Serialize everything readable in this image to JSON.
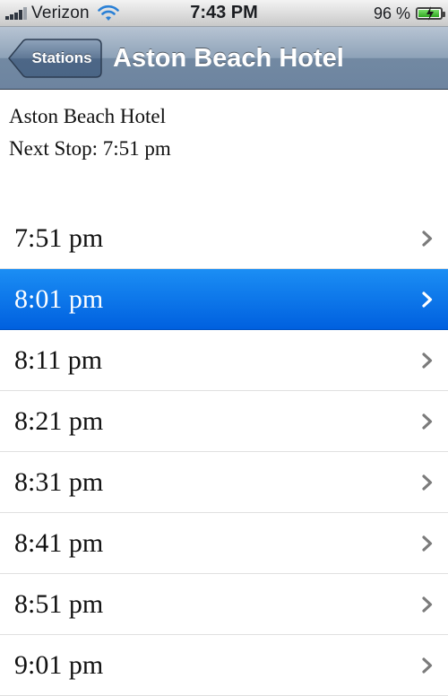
{
  "status_bar": {
    "carrier": "Verizon",
    "time": "7:43 PM",
    "battery_percent": "96 %",
    "battery_level": 0.96
  },
  "nav": {
    "back_label": "Stations",
    "title": "Aston Beach Hotel"
  },
  "info": {
    "station_name": "Aston Beach Hotel",
    "next_stop": "Next Stop: 7:51 pm"
  },
  "schedule": {
    "selected_index": 1,
    "times": [
      "7:51 pm",
      "8:01 pm",
      "8:11 pm",
      "8:21 pm",
      "8:31 pm",
      "8:41 pm",
      "8:51 pm",
      "9:01 pm"
    ]
  },
  "colors": {
    "selected_row": "#0a72ea",
    "nav_bar": "#8ea2b8",
    "chevron": "#7b7b7b"
  },
  "icons": {
    "wifi": "wifi-icon",
    "signal": "signal-bars-icon",
    "battery": "battery-charging-icon",
    "chevron": "chevron-right-icon"
  }
}
